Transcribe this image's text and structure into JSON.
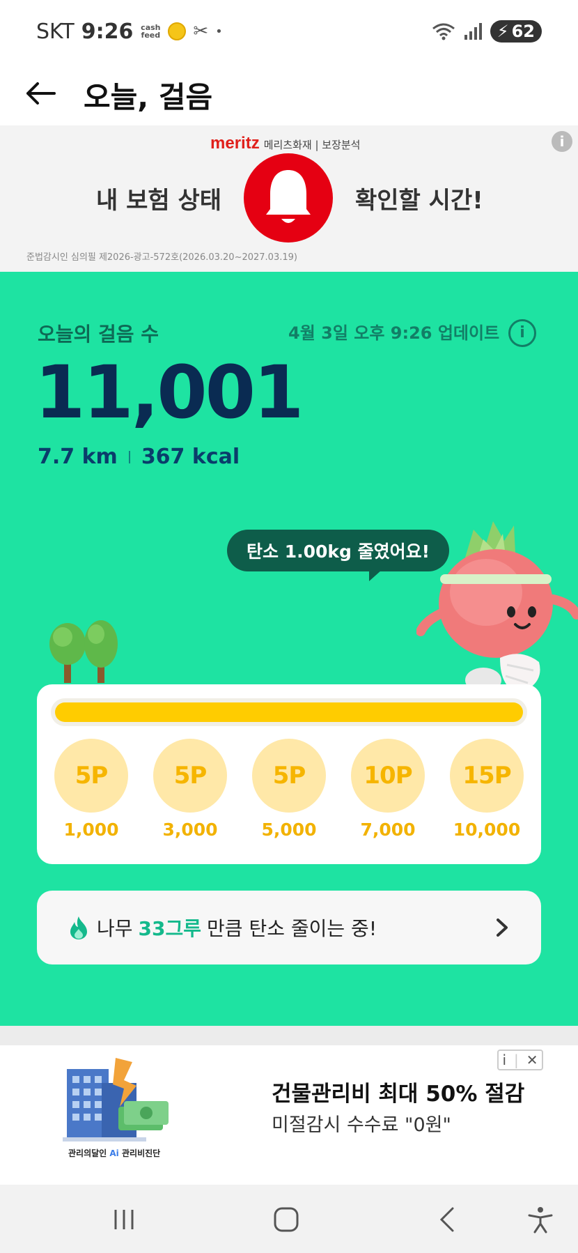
{
  "status_bar": {
    "carrier": "SKT",
    "time": "9:26",
    "cashfeed_label": "cash feed",
    "battery": "62"
  },
  "header": {
    "title": "오늘, 걸음"
  },
  "ad_top": {
    "brand": "meritz",
    "brand_sub": "메리츠화재 | 보장분석",
    "text_left": "내 보험 상태",
    "text_right": "확인할 시간!",
    "legal": "준법감시인 심의필 제2026-광고-572호(2026.03.20~2027.03.19)"
  },
  "steps": {
    "label": "오늘의 걸음 수",
    "update": "4월 3일 오후 9:26 업데이트",
    "count": "11,001",
    "distance": "7.7 km",
    "calories": "367 kcal"
  },
  "bubble": {
    "text": "탄소 1.00kg 줄였어요!"
  },
  "progress": {
    "fraction": 1.0,
    "rewards": [
      {
        "points": "5P",
        "steps": "1,000"
      },
      {
        "points": "5P",
        "steps": "3,000"
      },
      {
        "points": "5P",
        "steps": "5,000"
      },
      {
        "points": "10P",
        "steps": "7,000"
      },
      {
        "points": "15P",
        "steps": "10,000"
      }
    ]
  },
  "tree_card": {
    "prefix": "나무",
    "highlight": "33그루",
    "suffix": "만큼 탄소 줄이는 중!"
  },
  "ad_bottom": {
    "caption_prefix": "관리의달인",
    "caption_ai": "Ai",
    "caption_suffix": "관리비진단",
    "headline": "건물관리비 최대 50% 절감",
    "subline": "미절감시 수수료 \"0원\""
  },
  "colors": {
    "main_green": "#1ee3a2",
    "steps_navy": "#0a2b52",
    "reward_gold": "#f6b500",
    "progress_yellow": "#ffcc00",
    "meritz_red": "#e0201b"
  }
}
